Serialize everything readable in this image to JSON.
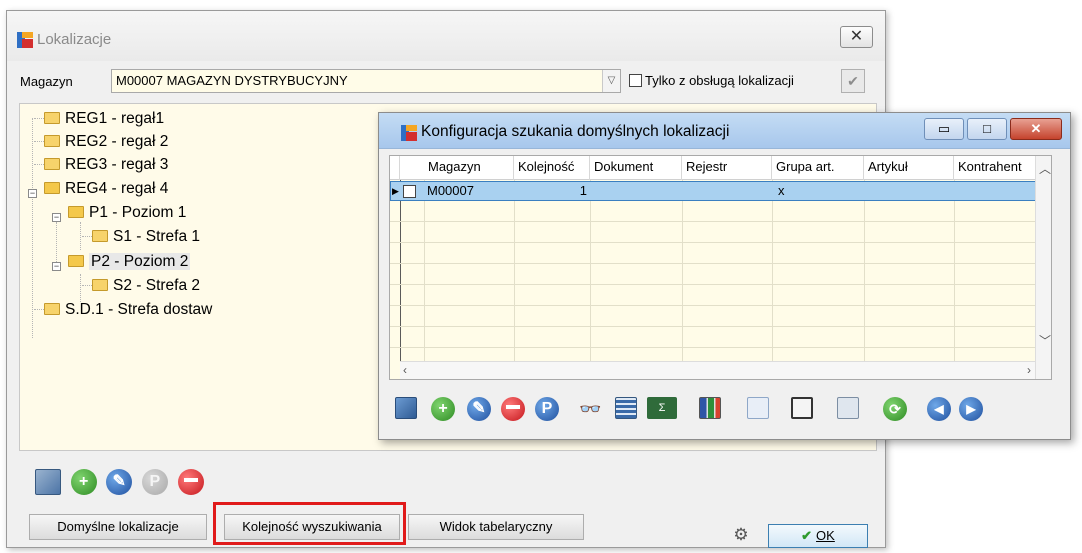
{
  "main_window": {
    "title": "Lokalizacje",
    "magazyn_label": "Magazyn",
    "magazyn_value": "M00007 MAGAZYN DYSTRYBUCYJNY",
    "only_with_locations_label": "Tylko z obsługą lokalizacji",
    "only_with_locations_checked": false,
    "tree": [
      {
        "label": "REG1 - regał1",
        "level": 0
      },
      {
        "label": "REG2 - regał 2",
        "level": 0
      },
      {
        "label": "REG3 - regał 3",
        "level": 0
      },
      {
        "label": "REG4 - regał 4",
        "level": 0,
        "expanded": true
      },
      {
        "label": "P1 - Poziom 1",
        "level": 1,
        "expanded": true
      },
      {
        "label": "S1 - Strefa 1",
        "level": 2
      },
      {
        "label": "P2 - Poziom 2",
        "level": 1,
        "expanded": true,
        "selected": true
      },
      {
        "label": "S2 - Strefa 2",
        "level": 2
      },
      {
        "label": "S.D.1 - Strefa dostaw",
        "level": 0
      }
    ],
    "buttons": {
      "default_locations": "Domyślne lokalizacje",
      "search_order": "Kolejność wyszukiwania",
      "table_view": "Widok tabelaryczny",
      "ok": "OK"
    }
  },
  "config_window": {
    "title": "Konfiguracja szukania domyślnych lokalizacji",
    "columns": [
      "Magazyn",
      "Kolejność",
      "Dokument",
      "Rejestr",
      "Grupa art.",
      "Artykuł",
      "Kontrahent"
    ],
    "rows": [
      {
        "magazyn": "M00007",
        "kolejnosc": "1",
        "dokument": "",
        "rejestr": "",
        "grupa_art": "x",
        "artykul": "",
        "kontrahent": ""
      }
    ]
  },
  "colors": {
    "highlight": "#e01a1a",
    "grid_background": "#fffce8",
    "selected_row": "#a9d1f0"
  }
}
